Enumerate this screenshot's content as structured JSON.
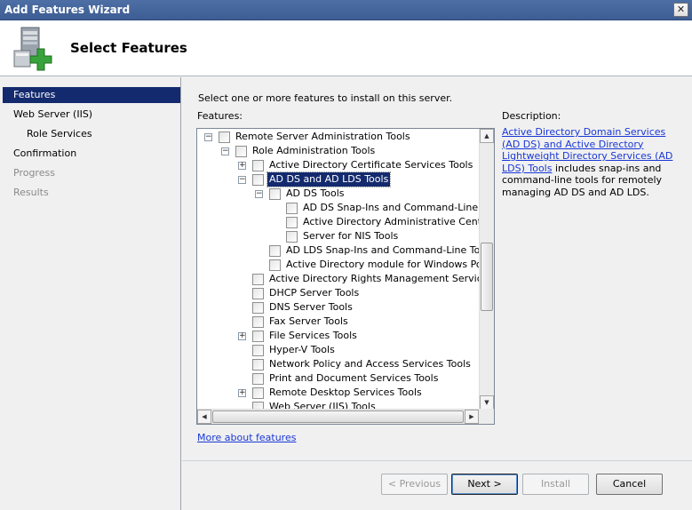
{
  "window": {
    "title": "Add Features Wizard",
    "close_glyph": "✕"
  },
  "header": {
    "title": "Select Features",
    "icon": "server-add-icon"
  },
  "sidebar": {
    "items": [
      {
        "label": "Features",
        "state": "active"
      },
      {
        "label": "Web Server (IIS)",
        "state": "normal"
      },
      {
        "label": "Role Services",
        "state": "sub"
      },
      {
        "label": "Confirmation",
        "state": "normal"
      },
      {
        "label": "Progress",
        "state": "disabled"
      },
      {
        "label": "Results",
        "state": "disabled"
      }
    ]
  },
  "main": {
    "intro": "Select one or more features to install on this server.",
    "features_label": "Features:",
    "description_label": "Description:",
    "description_link": "Active Directory Domain Services (AD DS) and Active Directory Lightweight Directory Services (AD LDS) Tools",
    "description_text": "includes snap-ins and command-line tools for remotely managing AD DS and AD LDS.",
    "more_link": "More about features"
  },
  "tree": [
    {
      "label": "Remote Server Administration Tools",
      "expander": "−",
      "checked": false
    },
    {
      "label": "Role Administration Tools",
      "expander": "−",
      "checked": false
    },
    {
      "label": "Active Directory Certificate Services Tools",
      "expander": "+",
      "checked": false
    },
    {
      "label": "AD DS and AD LDS Tools",
      "expander": "−",
      "checked": false,
      "selected": true
    },
    {
      "label": "AD DS Tools",
      "expander": "−",
      "checked": false
    },
    {
      "label": "AD DS Snap-Ins and Command-Line Tools",
      "expander": "",
      "checked": false
    },
    {
      "label": "Active Directory Administrative Center",
      "expander": "",
      "checked": false
    },
    {
      "label": "Server for NIS Tools",
      "expander": "",
      "checked": false
    },
    {
      "label": "AD LDS Snap-Ins and Command-Line Tools",
      "expander": "",
      "checked": false
    },
    {
      "label": "Active Directory module for Windows PowerShell",
      "expander": "",
      "checked": false
    },
    {
      "label": "Active Directory Rights Management Services Tools",
      "expander": "",
      "checked": false
    },
    {
      "label": "DHCP Server Tools",
      "expander": "",
      "checked": false
    },
    {
      "label": "DNS Server Tools",
      "expander": "",
      "checked": false
    },
    {
      "label": "Fax Server Tools",
      "expander": "",
      "checked": false
    },
    {
      "label": "File Services Tools",
      "expander": "+",
      "checked": false
    },
    {
      "label": "Hyper-V Tools",
      "expander": "",
      "checked": false
    },
    {
      "label": "Network Policy and Access Services Tools",
      "expander": "",
      "checked": false
    },
    {
      "label": "Print and Document Services Tools",
      "expander": "",
      "checked": false
    },
    {
      "label": "Remote Desktop Services Tools",
      "expander": "+",
      "checked": false
    },
    {
      "label": "Web Server (IIS) Tools",
      "expander": "",
      "checked": false
    }
  ],
  "scrollbar": {
    "up": "▲",
    "down": "▼",
    "left": "◀",
    "right": "▶"
  },
  "buttons": {
    "previous": "< Previous",
    "next": "Next >",
    "install": "Install",
    "cancel": "Cancel"
  },
  "colors": {
    "selection": "#142a6e",
    "link": "#1a38d6"
  }
}
